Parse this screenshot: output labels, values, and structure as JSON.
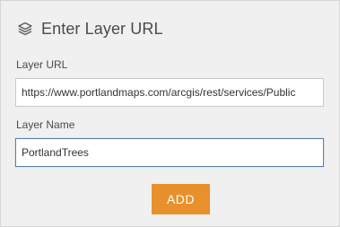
{
  "header": {
    "icon": "layers-icon",
    "title": "Enter Layer URL"
  },
  "layer_url": {
    "label": "Layer URL",
    "value": "https://www.portlandmaps.com/arcgis/rest/services/Public"
  },
  "layer_name": {
    "label": "Layer Name",
    "value": "PortlandTrees"
  },
  "actions": {
    "add_label": "ADD"
  },
  "colors": {
    "accent": "#e8902c",
    "focus_border": "#5b7fa8"
  }
}
